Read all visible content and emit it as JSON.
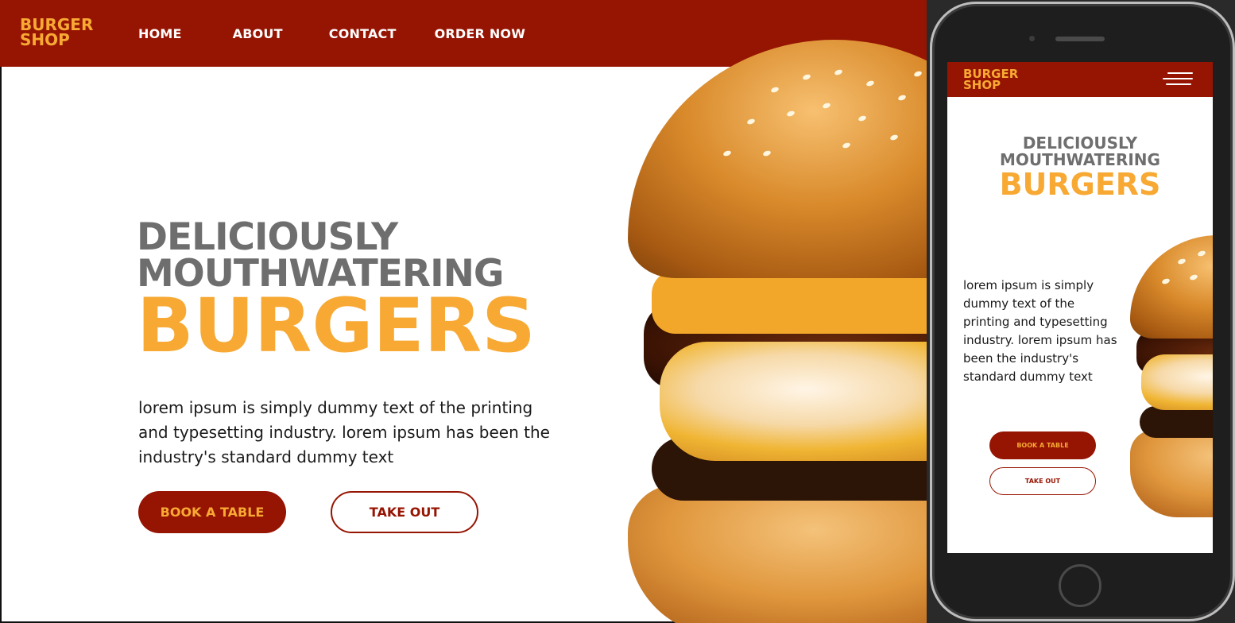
{
  "brand": {
    "logo_line1": "BURGER",
    "logo_line2": "SHOP",
    "primary_color": "#961402",
    "accent_color": "#f7a934",
    "heading_gray": "#6e6e6e"
  },
  "desktop": {
    "nav": {
      "items": [
        "HOME",
        "ABOUT",
        "CONTACT",
        "ORDER NOW"
      ]
    },
    "hero": {
      "line1": "DELICIOUSLY",
      "line2": "MOUTHWATERING",
      "highlight": "BURGERS",
      "description": "lorem ipsum is simply dummy text of the printing and typesetting industry. lorem ipsum has been the industry's standard dummy text",
      "primary_button": "BOOK A TABLE",
      "secondary_button": "TAKE OUT"
    }
  },
  "mobile": {
    "menu_icon": "hamburger-menu-icon",
    "hero": {
      "line1": "DELICIOUSLY",
      "line2": "MOUTHWATERING",
      "highlight": "BURGERS",
      "description": "lorem ipsum is simply dummy text of the printing and typesetting industry. lorem ipsum has been the industry's standard dummy text",
      "primary_button": "BOOK A TABLE",
      "secondary_button": "TAKE OUT"
    }
  }
}
